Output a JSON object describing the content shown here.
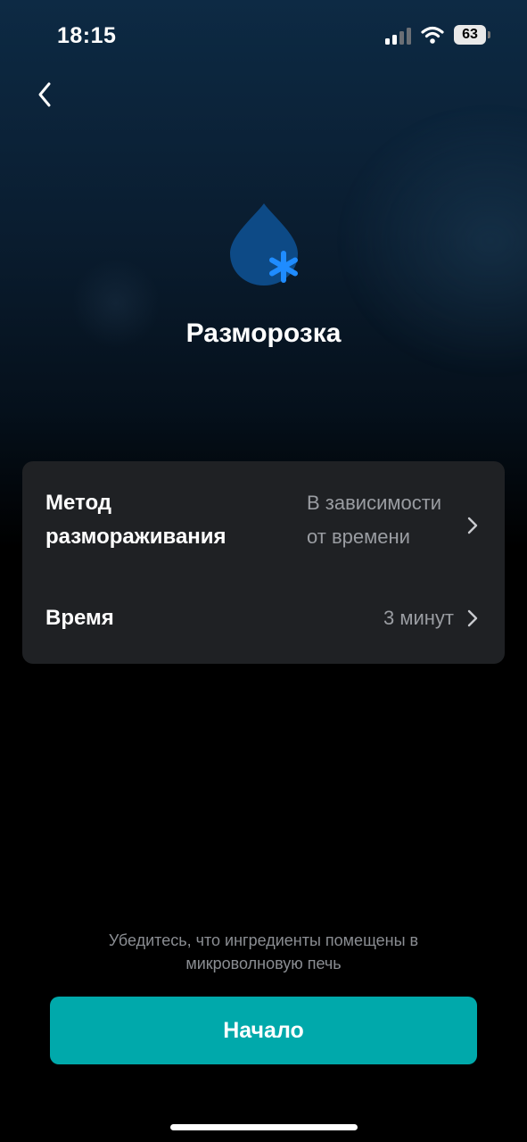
{
  "status_bar": {
    "time": "18:15",
    "battery": "63",
    "icons": [
      "signal-icon",
      "wifi-icon",
      "battery-icon"
    ]
  },
  "header": {
    "back_icon": "chevron-left-icon"
  },
  "hero": {
    "icon": "water-drop-snowflake-icon",
    "title": "Разморозка",
    "colors": {
      "drop": "#0d4a86",
      "snowflake": "#1f8cff"
    }
  },
  "settings": {
    "rows": [
      {
        "label": "Метод размораживания",
        "value": "В зависимости от времени",
        "icon": "chevron-right-icon"
      },
      {
        "label": "Время",
        "value": "3 минут",
        "icon": "chevron-right-icon"
      }
    ]
  },
  "footer": {
    "hint": "Убедитесь, что ингредиенты помещены в микроволновую печь",
    "start_label": "Начало",
    "accent_color": "#00a9ab"
  }
}
